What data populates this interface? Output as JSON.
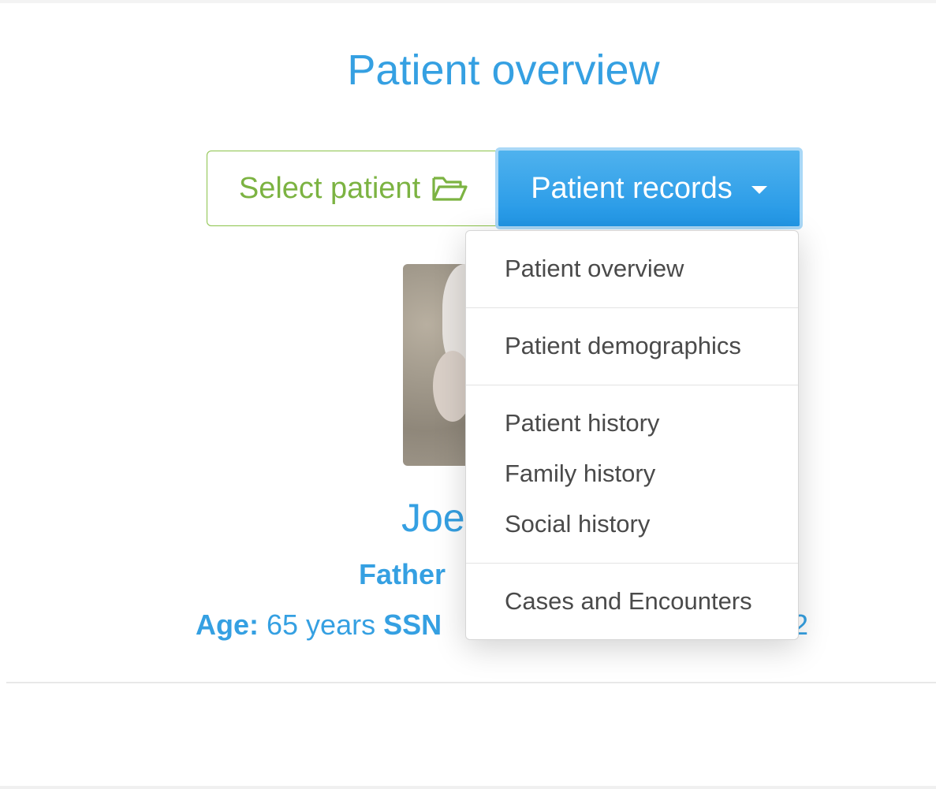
{
  "page": {
    "title": "Patient overview"
  },
  "toolbar": {
    "select_patient_label": "Select patient",
    "patient_records_label": "Patient records"
  },
  "patient": {
    "name": "Joe",
    "relation": "Father",
    "age_label": "Age:",
    "age_value": "65 years",
    "ssn_label": "SSN",
    "ssn_tail": "2"
  },
  "dropdown": {
    "items": [
      "Patient overview",
      "Patient demographics",
      "Patient history",
      "Family history",
      "Social history",
      "Cases and Encounters"
    ]
  },
  "colors": {
    "primary": "#35a0e2",
    "button_blue": "#2196e6",
    "success_green": "#7cb342"
  },
  "icons": {
    "select_patient": "folder-open-icon",
    "records": "caret-down-icon"
  }
}
